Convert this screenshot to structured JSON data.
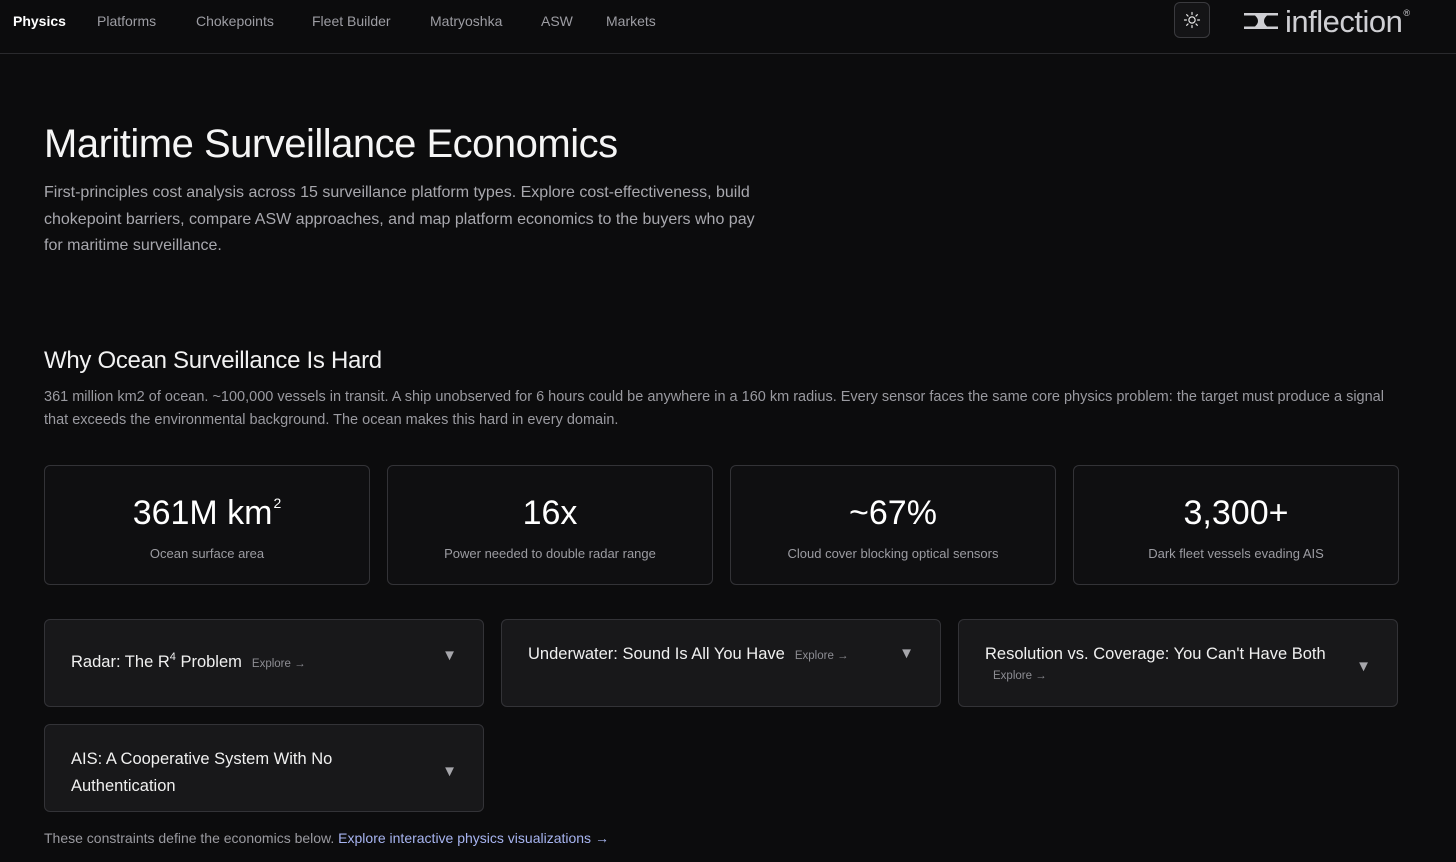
{
  "nav": {
    "tabs": [
      {
        "label": "Physics",
        "active": true
      },
      {
        "label": "Platforms",
        "active": false
      },
      {
        "label": "Chokepoints",
        "active": false
      },
      {
        "label": "Fleet Builder",
        "active": false
      },
      {
        "label": "Matryoshka",
        "active": false
      },
      {
        "label": "ASW",
        "active": false
      },
      {
        "label": "Markets",
        "active": false
      }
    ],
    "theme_icon": "sun-icon",
    "brand": {
      "word": "inflection",
      "reg": "®",
      "icon": "inflection-logo-mark"
    }
  },
  "hero": {
    "title": "Maritime Surveillance Economics",
    "subtitle": "First-principles cost analysis across 15 surveillance platform types. Explore cost-effectiveness, build chokepoint barriers, compare ASW approaches, and map platform economics to the buyers who pay for maritime surveillance."
  },
  "section": {
    "title": "Why Ocean Surveillance Is Hard",
    "description": "361 million km2 of ocean. ~100,000 vessels in transit. A ship unobserved for 6 hours could be anywhere in a 160 km radius. Every sensor faces the same core physics problem: the target must produce a signal that exceeds the environmental background. The ocean makes this hard in every domain."
  },
  "stats": [
    {
      "value": "361M km",
      "sup": "2",
      "label": "Ocean surface area"
    },
    {
      "value": "16x",
      "sup": "",
      "label": "Power needed to double radar range"
    },
    {
      "value": "~67%",
      "sup": "",
      "label": "Cloud cover blocking optical sensors"
    },
    {
      "value": "3,300+",
      "sup": "",
      "label": "Dark fleet vessels evading AIS"
    }
  ],
  "accordions": [
    {
      "title": "Radar: The R",
      "sup": "4",
      "title_after": " Problem",
      "explore": "Explore →",
      "arrow": "▼"
    },
    {
      "title": "Underwater: Sound Is All You Have",
      "sup": "",
      "title_after": "",
      "explore": "Explore →",
      "arrow": "▼"
    },
    {
      "title": "Resolution vs. Coverage: You Can't Have Both",
      "sup": "",
      "title_after": "",
      "explore": "Explore →",
      "arrow": "▼"
    },
    {
      "title": "AIS: A Cooperative System With No Authentication",
      "sup": "",
      "title_after": "",
      "explore": "",
      "arrow": "▼"
    }
  ],
  "note": {
    "text": "These constraints define the economics below. ",
    "link": "Explore interactive physics visualizations →"
  },
  "colors": {
    "background": "#0c0c0d",
    "card": "#18181a",
    "border": "#333337",
    "link": "#a7b4f0"
  }
}
